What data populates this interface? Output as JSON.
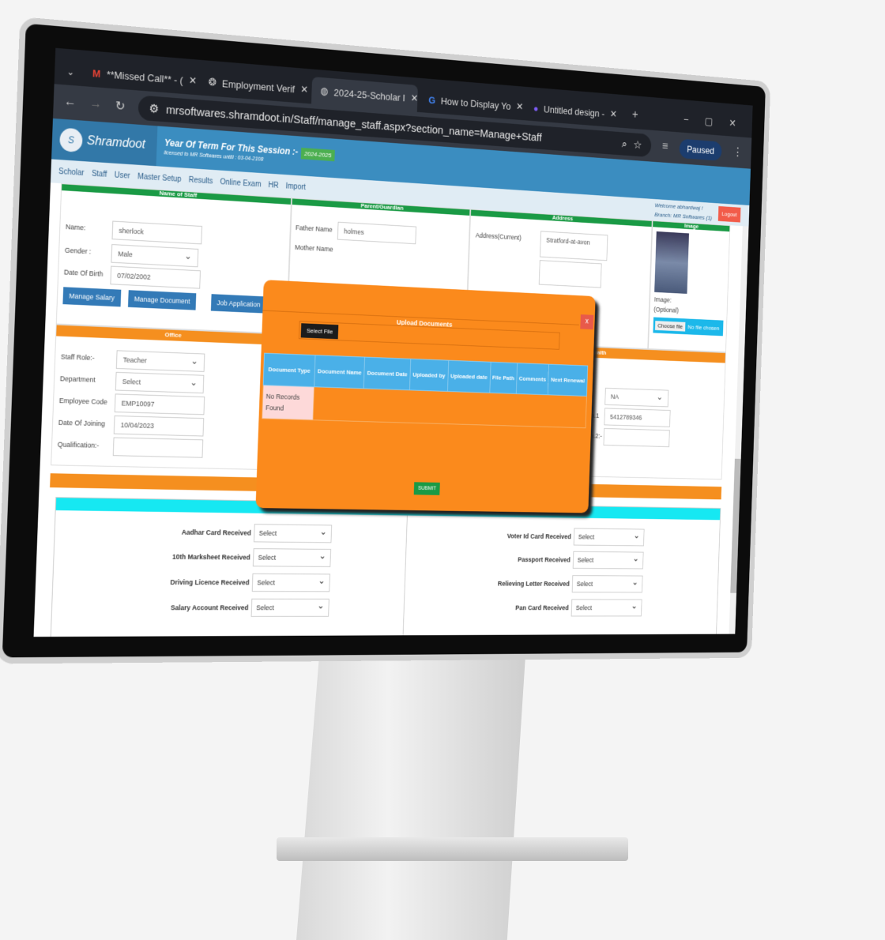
{
  "browser": {
    "tabs": [
      {
        "title": "**Missed Call** - (",
        "icon": "gmail-icon"
      },
      {
        "title": "Employment Verif",
        "icon": "chatgpt-icon"
      },
      {
        "title": "2024-25-Scholar I",
        "icon": "globe-icon",
        "active": true
      },
      {
        "title": "How to Display Yo",
        "icon": "google-icon"
      },
      {
        "title": "Untitled design -",
        "icon": "canva-icon"
      }
    ],
    "url": "mrsoftwares.shramdoot.in/Staff/manage_staff.aspx?section_name=Manage+Staff",
    "profile": "Paused"
  },
  "header": {
    "logo_text": "Shramdoot",
    "logo_letter": "S",
    "session_label": "Year Of Term For This Session :-",
    "session_value": "2024-2025",
    "license": "licensed to MR Softwares untill : 03-04-2108",
    "welcome": "Welcome abhardwaj !",
    "branch": "Branch: MR Softwares (1)",
    "logout": "Logout"
  },
  "nav": [
    "Scholar",
    "Staff",
    "User",
    "Master Setup",
    "Results",
    "Online Exam",
    "HR",
    "Import"
  ],
  "form": {
    "sections": {
      "name": "Name of Staff",
      "parent": "Parent/Guardian",
      "address": "Address",
      "image": "Image",
      "office": "Office",
      "health": "Health"
    },
    "name_label": "Name:",
    "name": "sherlock",
    "gender_label": "Gender :",
    "gender": "Male",
    "dob_label": "Date Of Birth",
    "dob": "07/02/2002",
    "father_label": "Father Name",
    "father": "holmes",
    "mother_label": "Mother Name",
    "address_label": "Address(Current)",
    "address": "Stratford-at-avon",
    "image_label": "Image:",
    "image_optional": "(Optional)",
    "choose_file": "Choose file",
    "no_file": "No file chosen",
    "buttons": [
      "Manage Salary",
      "Manage Document",
      "Job Application"
    ],
    "staff_role_label": "Staff Role:-",
    "staff_role": "Teacher",
    "department_label": "Department",
    "department": "Select",
    "emp_code_label": "Employee Code",
    "emp_code": "EMP10097",
    "doj_label": "Date Of Joining",
    "doj": "10/04/2023",
    "qualification_label": "Qualification:-",
    "health_select": "NA",
    "person1_label": "erson.1",
    "person1": "5412789346",
    "person2_label": "erson.2:-"
  },
  "modal": {
    "title": "Upload Documents",
    "select_file": "Select File",
    "close": "x",
    "columns": [
      "Document Type",
      "Document Name",
      "Document Date",
      "Uploaded by",
      "Uploaded date",
      "File Path",
      "Comments",
      "Next Renewal"
    ],
    "empty": "No Records Found",
    "submit": "SUBMIT"
  },
  "documents": {
    "left": [
      {
        "label": "Aadhar Card Received",
        "value": "Select"
      },
      {
        "label": "10th Marksheet Received",
        "value": "Select"
      },
      {
        "label": "Driving Licence Received",
        "value": "Select"
      },
      {
        "label": "Salary Account Received",
        "value": "Select"
      }
    ],
    "right": [
      {
        "label": "Voter Id Card Received",
        "value": "Select"
      },
      {
        "label": "Passport Received",
        "value": "Select"
      },
      {
        "label": "Relieving Letter Received",
        "value": "Select"
      },
      {
        "label": "Pan Card Received",
        "value": "Select"
      }
    ]
  },
  "colors": {
    "header": "#3b8dc0",
    "modal": "#fb8a1c",
    "section_green": "#1a9a45",
    "section_orange": "#f58f1f",
    "table_header": "#4ab0e8",
    "cyan": "#16e8f2"
  }
}
